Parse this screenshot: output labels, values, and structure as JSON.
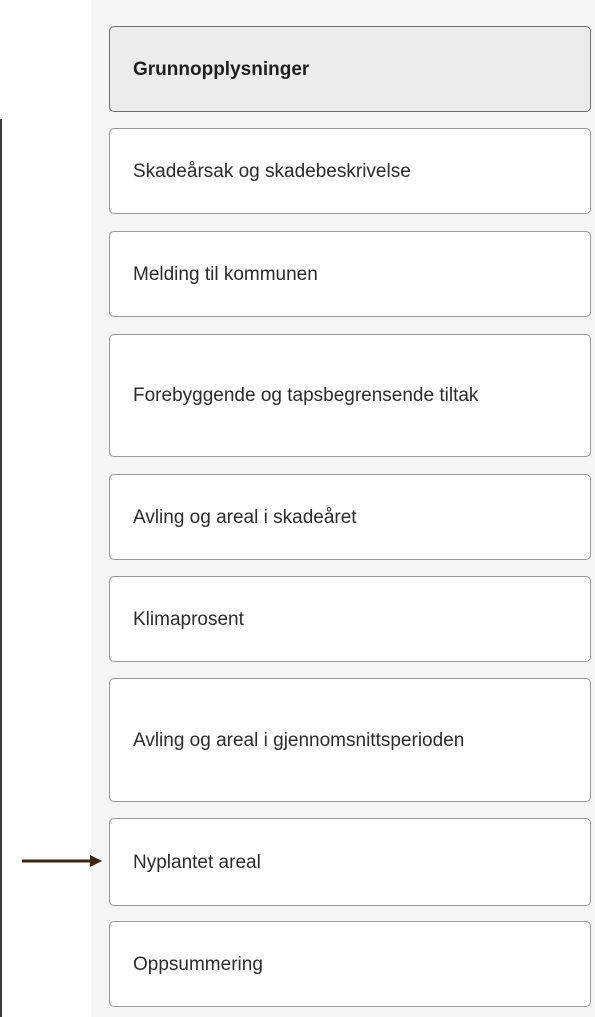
{
  "steps": [
    {
      "label": "Grunnopplysninger",
      "active": true
    },
    {
      "label": "Skadeårsak og skadebeskrivelse",
      "active": false
    },
    {
      "label": "Melding til kommunen",
      "active": false
    },
    {
      "label": "Forebyggende og tapsbegrensende tiltak",
      "active": false
    },
    {
      "label": "Avling og areal i skadeåret",
      "active": false
    },
    {
      "label": "Klimaprosent",
      "active": false
    },
    {
      "label": "Avling og areal i gjennomsnittsperioden",
      "active": false
    },
    {
      "label": "Nyplantet areal",
      "active": false
    },
    {
      "label": "Oppsummering",
      "active": false
    }
  ],
  "colors": {
    "panel_background": "#f5f5f5",
    "active_step_background": "#ececec",
    "step_border": "#9a9a9a",
    "arrow": "#3b2410"
  },
  "annotation": {
    "arrow_icon": "right-arrow-icon",
    "points_to": "Nyplantet areal"
  }
}
